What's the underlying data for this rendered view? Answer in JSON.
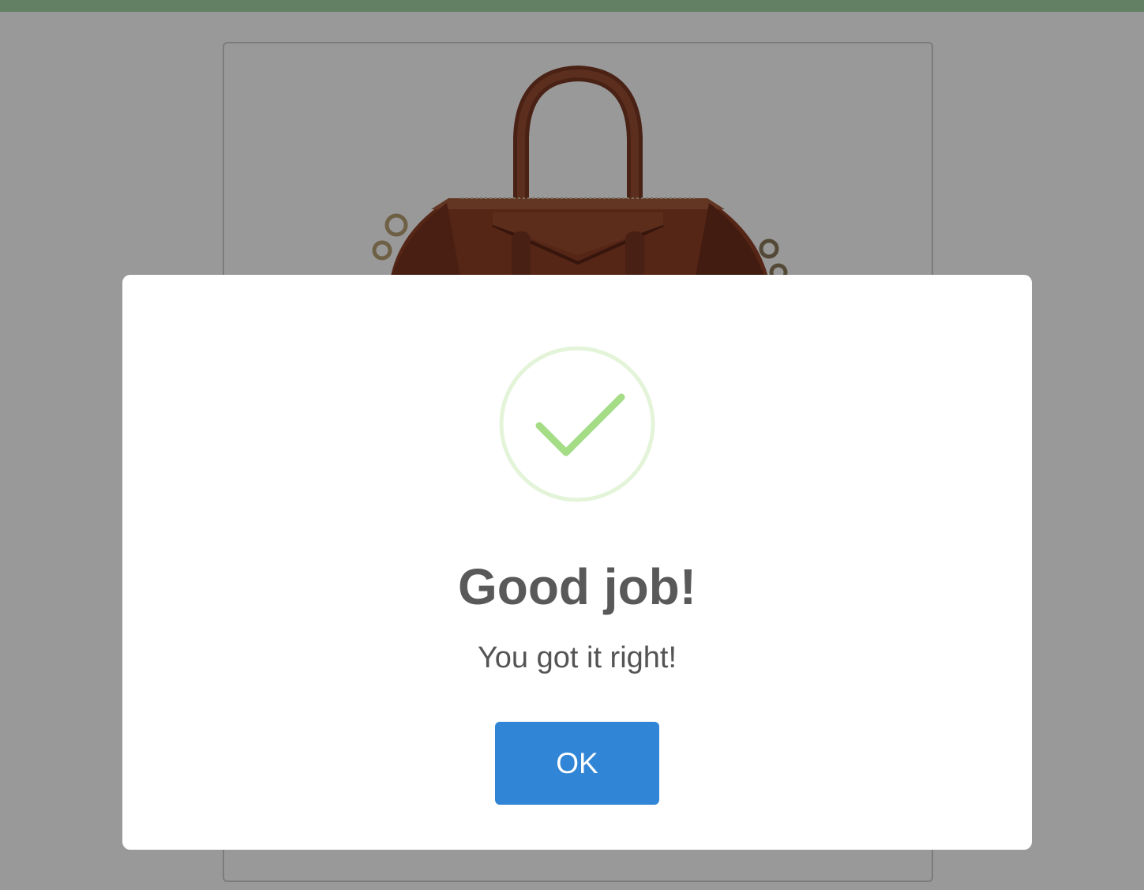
{
  "modal": {
    "title": "Good job!",
    "text": "You got it right!",
    "confirm_label": "OK",
    "icon": "success-checkmark-icon"
  },
  "colors": {
    "top_bar": "#a5d6a7",
    "confirm_button": "#3085d6",
    "success_green": "#a5dc86",
    "success_ring": "#e3f4d9",
    "title_text": "#595959",
    "body_text": "#545454",
    "overlay": "rgba(0,0,0,0.4)"
  },
  "background": {
    "product_image": "brown-leather-handbag"
  }
}
